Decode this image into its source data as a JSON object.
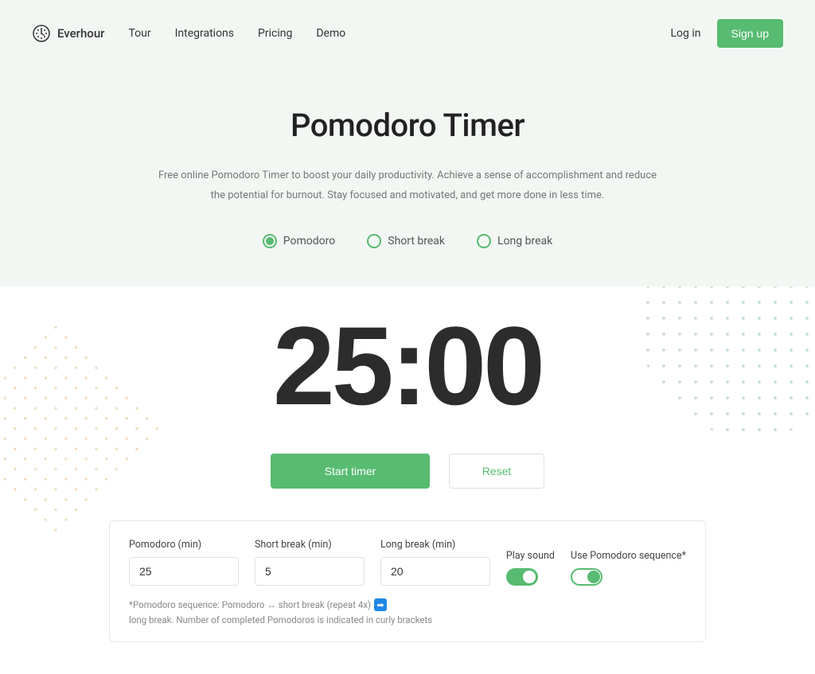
{
  "header": {
    "brand": "Everhour",
    "nav": [
      "Tour",
      "Integrations",
      "Pricing",
      "Demo"
    ],
    "login": "Log in",
    "signup": "Sign up"
  },
  "hero": {
    "title": "Pomodoro Timer",
    "description": "Free online Pomodoro Timer to boost your daily productivity. Achieve a sense of accomplishment and reduce the potential for burnout. Stay focused and motivated, and get more done in less time."
  },
  "modes": [
    {
      "label": "Pomodoro",
      "selected": true
    },
    {
      "label": "Short break",
      "selected": false
    },
    {
      "label": "Long break",
      "selected": false
    }
  ],
  "timer": {
    "display": "25:00",
    "start_label": "Start timer",
    "reset_label": "Reset"
  },
  "settings": {
    "pomodoro": {
      "label": "Pomodoro (min)",
      "value": "25"
    },
    "short_break": {
      "label": "Short break (min)",
      "value": "5"
    },
    "long_break": {
      "label": "Long break (min)",
      "value": "20"
    },
    "play_sound": {
      "label": "Play sound",
      "on": true
    },
    "use_sequence": {
      "label": "Use Pomodoro sequence*",
      "on": true
    },
    "note_prefix": "*Pomodoro sequence: Pomodoro ↔ short break (repeat 4x) ",
    "note_suffix": " long break. Number of completed Pomodoros is indicated in curly brackets"
  }
}
